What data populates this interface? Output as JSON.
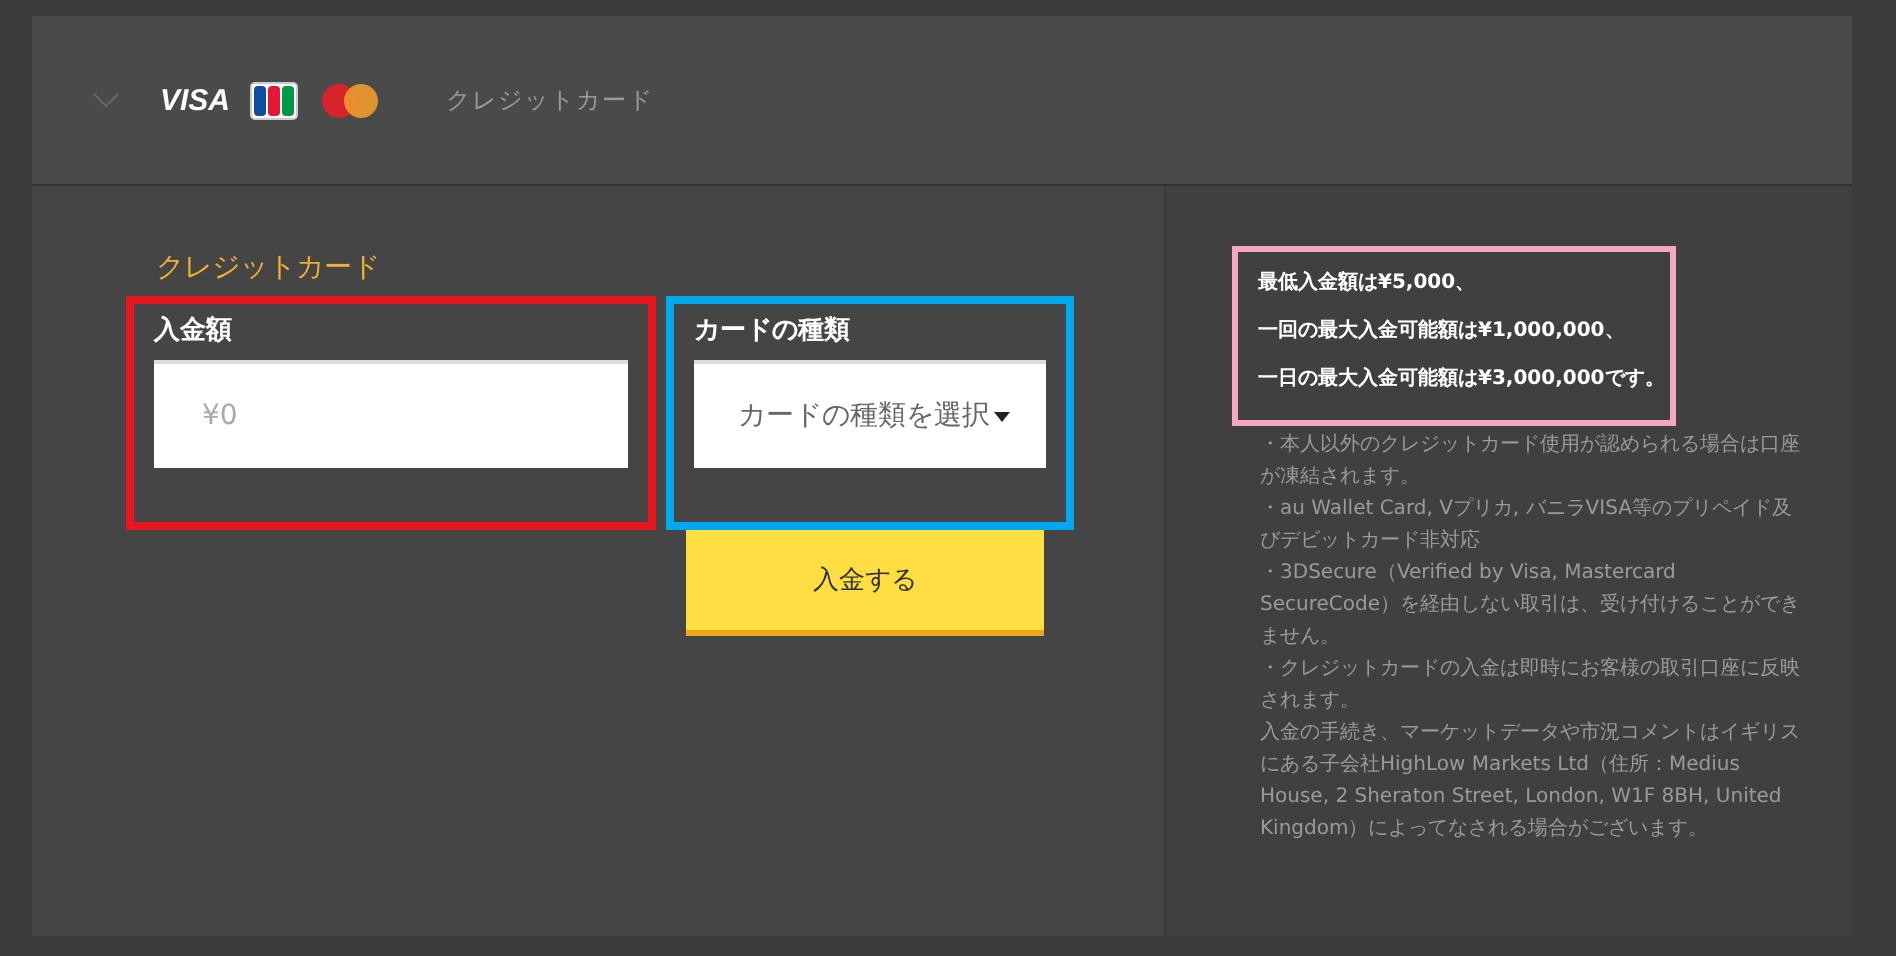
{
  "header": {
    "expanded": false,
    "brands": [
      "VISA"
    ],
    "title": "クレジットカード"
  },
  "form": {
    "heading": "クレジットカード",
    "amount": {
      "label": "入金額",
      "placeholder": "¥0"
    },
    "card_type": {
      "label": "カードの種類",
      "value": "カードの種類を選択"
    },
    "submit": "入金する"
  },
  "limits": [
    "最低入金額は¥5,000、",
    "一回の最大入金可能額は¥1,000,000、",
    "一日の最大入金可能額は¥3,000,000です。"
  ],
  "notes": [
    "・本人以外のクレジットカード使用が認められる場合は口座が凍結されます。",
    "・au Wallet Card, Vプリカ, バニラVISA等のプリペイド及びデビットカード非対応",
    "・3DSecure（Verified by Visa, Mastercard SecureCode）を経由しない取引は、受け付けることができません。",
    "・クレジットカードの入金は即時にお客様の取引口座に反映されます。",
    "入金の手続き、マーケットデータや市況コメントはイギリスにある子会社HighLow Markets Ltd（住所：Medius House, 2 Sheraton Street, London, W1F 8BH, United Kingdom）によってなされる場合がございます。"
  ]
}
